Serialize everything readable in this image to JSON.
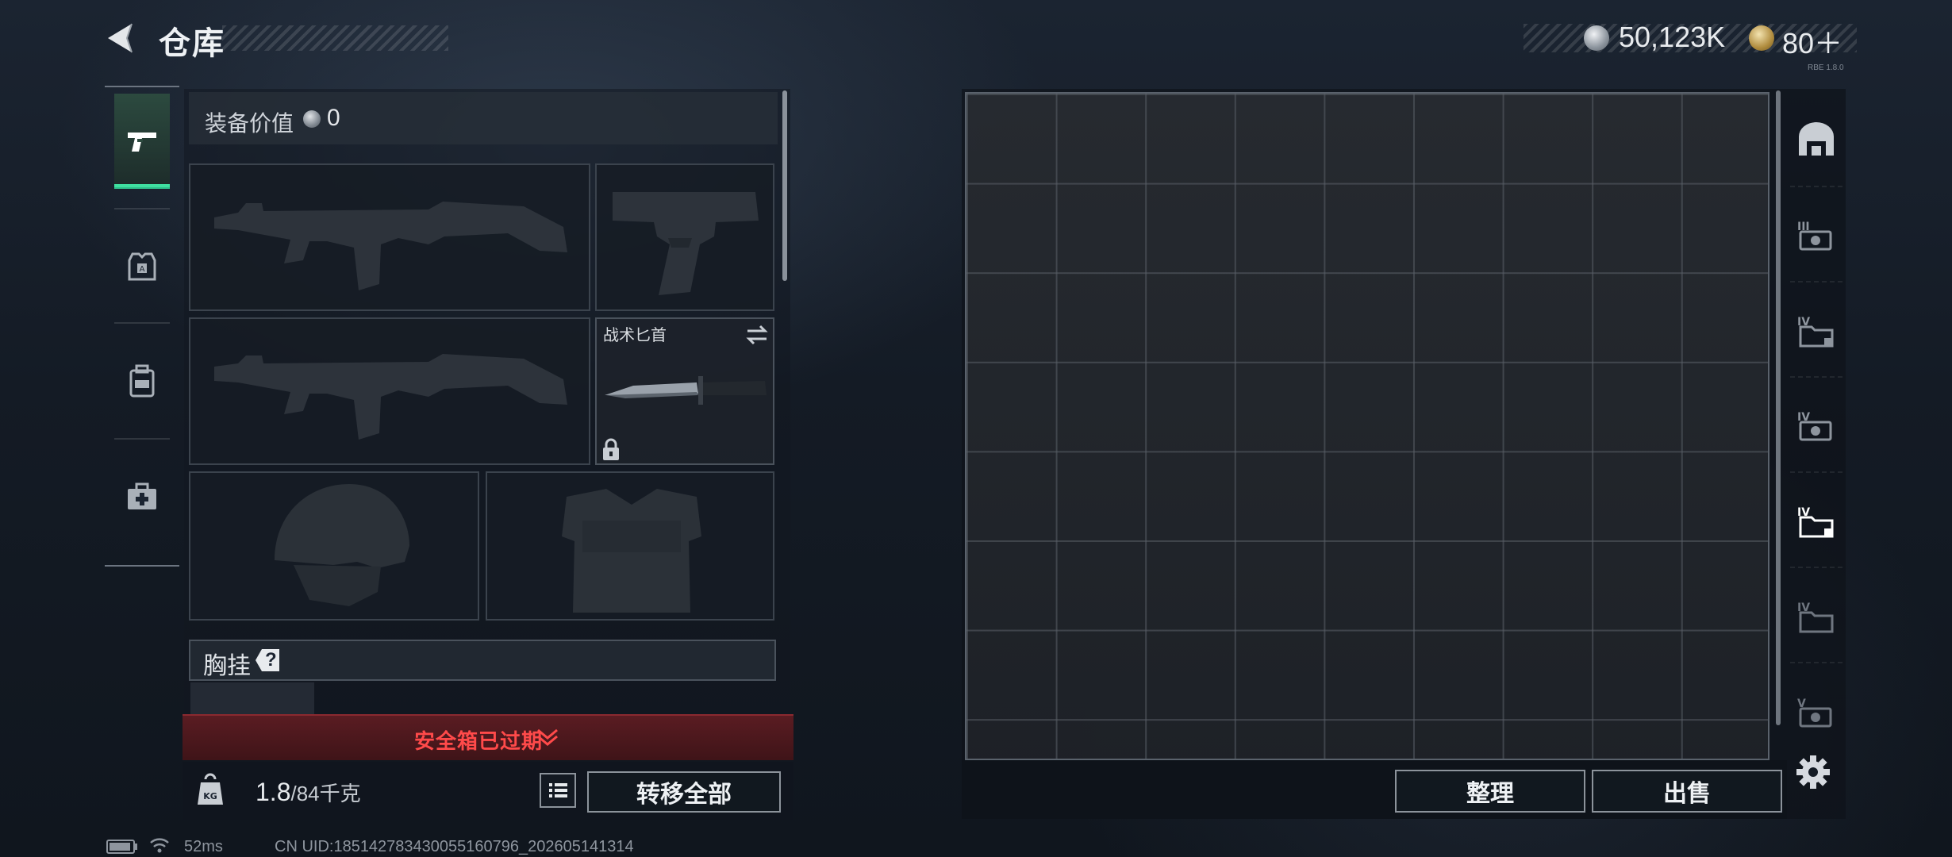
{
  "header": {
    "title": "仓库",
    "currencies": [
      {
        "name": "silver-coin",
        "value": "50,123K"
      },
      {
        "name": "gold-coin",
        "value": "80＋"
      }
    ],
    "tiny_tag": "RBE 1.8.0"
  },
  "tabs": [
    {
      "name": "weapons",
      "icon": "pistol-icon",
      "active": true
    },
    {
      "name": "gear",
      "icon": "armor-icon",
      "active": false
    },
    {
      "name": "backpack",
      "icon": "backpack-icon",
      "active": false
    },
    {
      "name": "supplies",
      "icon": "medkit-icon",
      "active": false
    }
  ],
  "equipment": {
    "title": "装备价值",
    "value": "0",
    "slots": [
      {
        "name": "primary-weapon-1",
        "item": "rifle-silhouette"
      },
      {
        "name": "sidearm",
        "item": "pistol-silhouette"
      },
      {
        "name": "primary-weapon-2",
        "item": "rifle-silhouette"
      },
      {
        "name": "melee",
        "label": "战术匕首",
        "item": "knife",
        "locked": true
      },
      {
        "name": "helmet",
        "item": "helmet-silhouette"
      },
      {
        "name": "body-armor",
        "item": "vest-silhouette"
      }
    ],
    "chest_rig_label": "胸挂",
    "chest_rig_help": "?",
    "safe_box_text": "安全箱已过期",
    "weight_current": "1.8",
    "weight_max": "/84千克",
    "transfer_all_label": "转移全部"
  },
  "storage": {
    "sort_label": "整理",
    "sell_label": "出售",
    "side_icons": [
      "storage-main-icon",
      "case-iii-icon",
      "case-iv-icon",
      "case-iv-2-icon",
      "case-iv-active-icon",
      "case-iv-3-icon",
      "case-v-icon"
    ]
  },
  "footer": {
    "ping": "52ms",
    "uid": "CN UID:185142783430055160796_202605141314"
  },
  "colors": {
    "accent_green": "#2fbf8a",
    "alert_red": "#ff4a4a"
  }
}
